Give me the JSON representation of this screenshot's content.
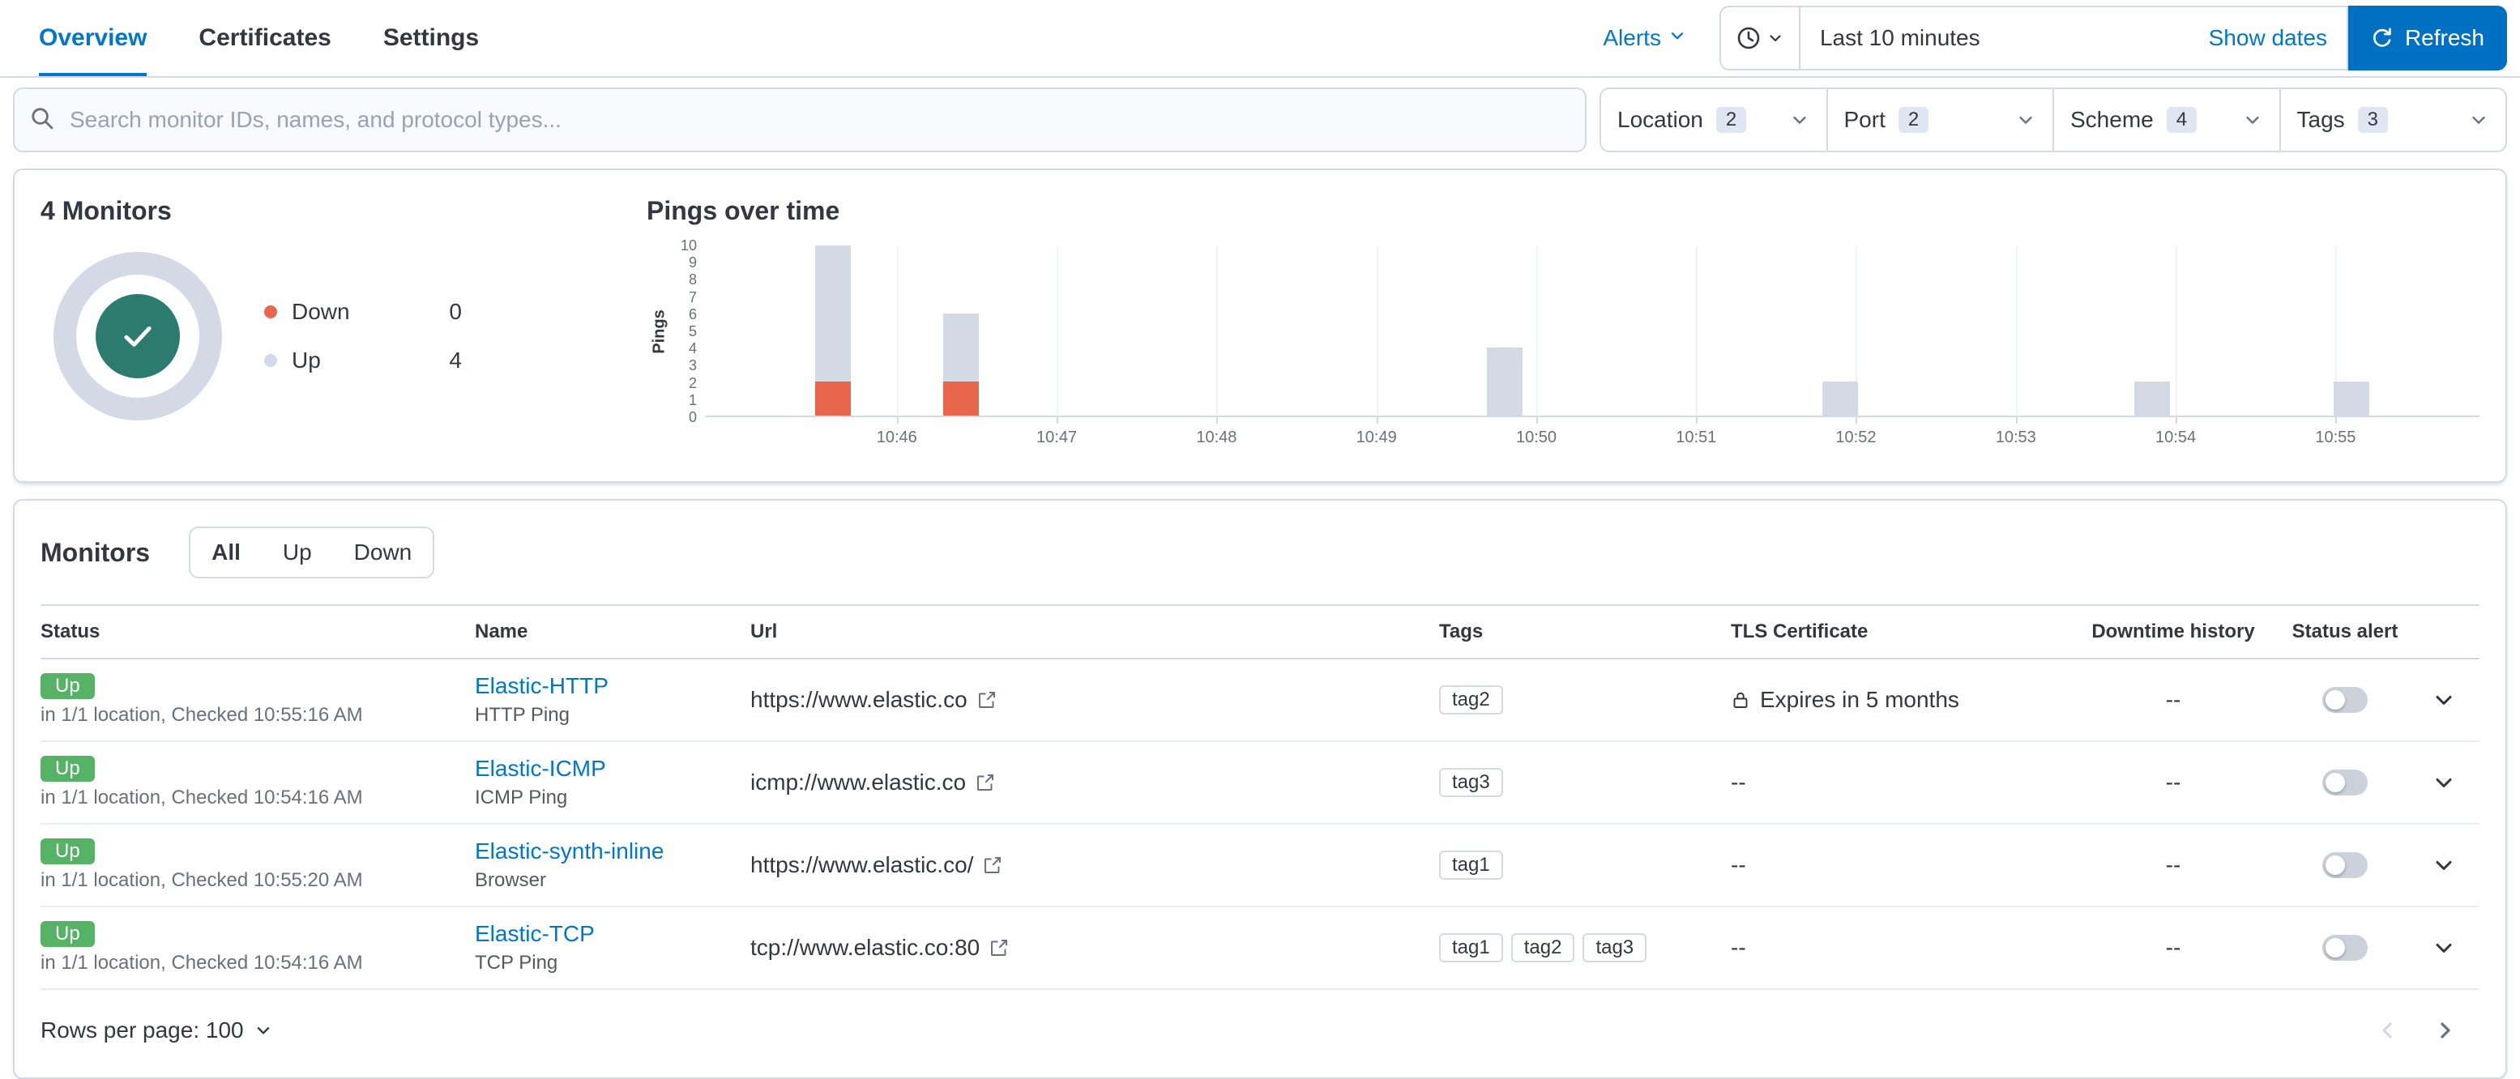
{
  "tabs": [
    {
      "label": "Overview",
      "active": true
    },
    {
      "label": "Certificates",
      "active": false
    },
    {
      "label": "Settings",
      "active": false
    }
  ],
  "header": {
    "alerts_label": "Alerts",
    "time_range": "Last 10 minutes",
    "show_dates": "Show dates",
    "refresh_label": "Refresh"
  },
  "search": {
    "placeholder": "Search monitor IDs, names, and protocol types..."
  },
  "filters": [
    {
      "label": "Location",
      "count": "2"
    },
    {
      "label": "Port",
      "count": "2"
    },
    {
      "label": "Scheme",
      "count": "4"
    },
    {
      "label": "Tags",
      "count": "3"
    }
  ],
  "summary": {
    "title": "4 Monitors",
    "legend": [
      {
        "label": "Down",
        "value": "0",
        "color": "#E7664C"
      },
      {
        "label": "Up",
        "value": "4",
        "color": "#D3DAE6"
      }
    ]
  },
  "chart_data": {
    "type": "bar",
    "stacked": true,
    "title": "Pings over time",
    "ylabel": "Pings",
    "ylim": [
      0,
      10
    ],
    "yticks": [
      0,
      1,
      2,
      3,
      4,
      5,
      6,
      7,
      8,
      9,
      10
    ],
    "x_axis_minutes": [
      44.8,
      55.9
    ],
    "xticks": [
      {
        "label": "10:46",
        "minute": 46
      },
      {
        "label": "10:47",
        "minute": 47
      },
      {
        "label": "10:48",
        "minute": 48
      },
      {
        "label": "10:49",
        "minute": 49
      },
      {
        "label": "10:50",
        "minute": 50
      },
      {
        "label": "10:51",
        "minute": 51
      },
      {
        "label": "10:52",
        "minute": 52
      },
      {
        "label": "10:53",
        "minute": 53
      },
      {
        "label": "10:54",
        "minute": 54
      },
      {
        "label": "10:55",
        "minute": 55
      }
    ],
    "series": [
      {
        "name": "Up",
        "color": "#D3DAE6"
      },
      {
        "name": "Down",
        "color": "#E7664C"
      }
    ],
    "bars": [
      {
        "minute": 45.6,
        "up": 8,
        "down": 2
      },
      {
        "minute": 46.4,
        "up": 4,
        "down": 2
      },
      {
        "minute": 49.8,
        "up": 4,
        "down": 0
      },
      {
        "minute": 51.9,
        "up": 2,
        "down": 0
      },
      {
        "minute": 53.85,
        "up": 2,
        "down": 0
      },
      {
        "minute": 55.1,
        "up": 2,
        "down": 0
      }
    ]
  },
  "monitors": {
    "title": "Monitors",
    "tabs": [
      "All",
      "Up",
      "Down"
    ],
    "selected": "All",
    "columns": [
      {
        "label": "Status",
        "center": false
      },
      {
        "label": "Name",
        "center": false
      },
      {
        "label": "Url",
        "center": false
      },
      {
        "label": "Tags",
        "center": false
      },
      {
        "label": "TLS Certificate",
        "center": false
      },
      {
        "label": "Downtime history",
        "center": true
      },
      {
        "label": "Status alert",
        "center": true
      }
    ],
    "rows": [
      {
        "status": "Up",
        "checked": "in 1/1 location, Checked 10:55:16 AM",
        "name": "Elastic-HTTP",
        "type": "HTTP Ping",
        "url": "https://www.elastic.co",
        "tags": [
          "tag2"
        ],
        "tls": "Expires in 5 months",
        "tls_has_lock": true,
        "downtime": "--",
        "alert_on": false
      },
      {
        "status": "Up",
        "checked": "in 1/1 location, Checked 10:54:16 AM",
        "name": "Elastic-ICMP",
        "type": "ICMP Ping",
        "url": "icmp://www.elastic.co",
        "tags": [
          "tag3"
        ],
        "tls": "--",
        "tls_has_lock": false,
        "downtime": "--",
        "alert_on": false
      },
      {
        "status": "Up",
        "checked": "in 1/1 location, Checked 10:55:20 AM",
        "name": "Elastic-synth-inline",
        "type": "Browser",
        "url": "https://www.elastic.co/",
        "tags": [
          "tag1"
        ],
        "tls": "--",
        "tls_has_lock": false,
        "downtime": "--",
        "alert_on": false
      },
      {
        "status": "Up",
        "checked": "in 1/1 location, Checked 10:54:16 AM",
        "name": "Elastic-TCP",
        "type": "TCP Ping",
        "url": "tcp://www.elastic.co:80",
        "tags": [
          "tag1",
          "tag2",
          "tag3"
        ],
        "tls": "--",
        "tls_has_lock": false,
        "downtime": "--",
        "alert_on": false
      }
    ]
  },
  "footer": {
    "rows_per_page": "Rows per page: 100"
  },
  "colors": {
    "primary": "#0077CC",
    "refresh_button": "#0071C2",
    "up_badge": "#56B366",
    "down": "#E7664C",
    "bar_up": "#D3DAE6",
    "donut_center": "#2B7C6E",
    "border": "#D3DAE6",
    "text": "#343741",
    "subdued": "#69707D"
  },
  "icons": {
    "search": "magnifier",
    "clock": "clock",
    "chevron": "chevron-down",
    "refresh": "refresh-arrow",
    "external": "external-link",
    "lock": "padlock",
    "check": "checkmark"
  }
}
